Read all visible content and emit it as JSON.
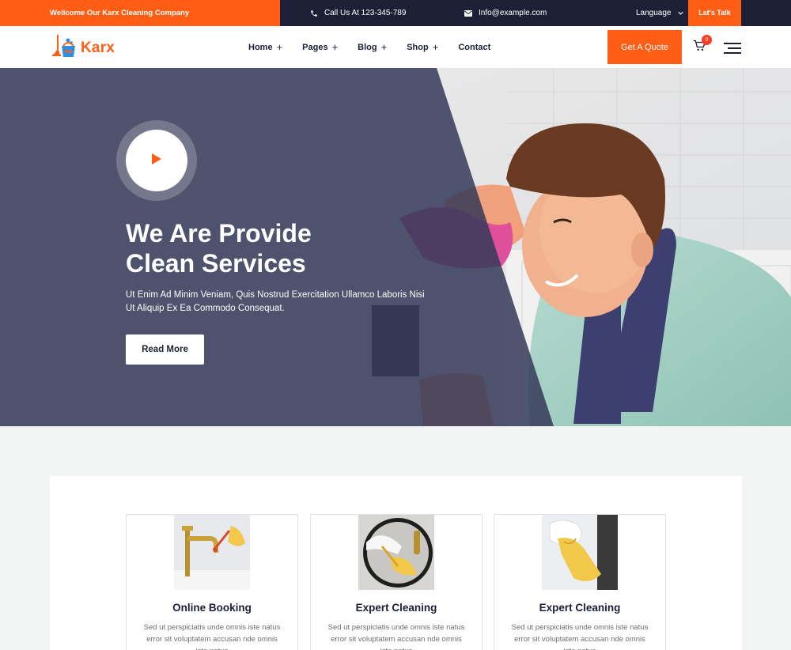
{
  "topbar": {
    "welcome": "Wellcome Our Karx Cleaning Company",
    "phone_text": "Call Us At 123-345-789",
    "email_text": "Info@example.com",
    "language_label": "Language",
    "lets_talk_label": "Lat's Talk"
  },
  "header": {
    "logo_text": "Karx",
    "nav": [
      {
        "label": "Home",
        "has_submenu": true
      },
      {
        "label": "Pages",
        "has_submenu": true
      },
      {
        "label": "Blog",
        "has_submenu": true
      },
      {
        "label": "Shop",
        "has_submenu": true
      },
      {
        "label": "Contact",
        "has_submenu": false
      }
    ],
    "quote_label": "Get A Quote",
    "cart_count": "0"
  },
  "hero": {
    "title_line1": "We Are Provide",
    "title_line2": "Clean Services",
    "description": "Ut Enim Ad Minim Veniam, Quis Nostrud Exercitation Ullamco Laboris Nisi Ut Aliquip Ex Ea Commodo Consequat.",
    "button_label": "Read More"
  },
  "services": [
    {
      "title": "Online Booking",
      "text": "Sed ut perspiciatis unde omnis iste natus error sit voluptatem accusan nde omnis iste natus"
    },
    {
      "title": "Expert Cleaning",
      "text": "Sed ut perspiciatis unde omnis iste natus error sit voluptatem accusan nde omnis iste natus"
    },
    {
      "title": "Expert Cleaning",
      "text": "Sed ut perspiciatis unde omnis iste natus error sit voluptatem accusan nde omnis iste natus"
    }
  ],
  "colors": {
    "accent": "#ff5e14",
    "dark": "#1c1f35",
    "overlay": "#363a58"
  }
}
